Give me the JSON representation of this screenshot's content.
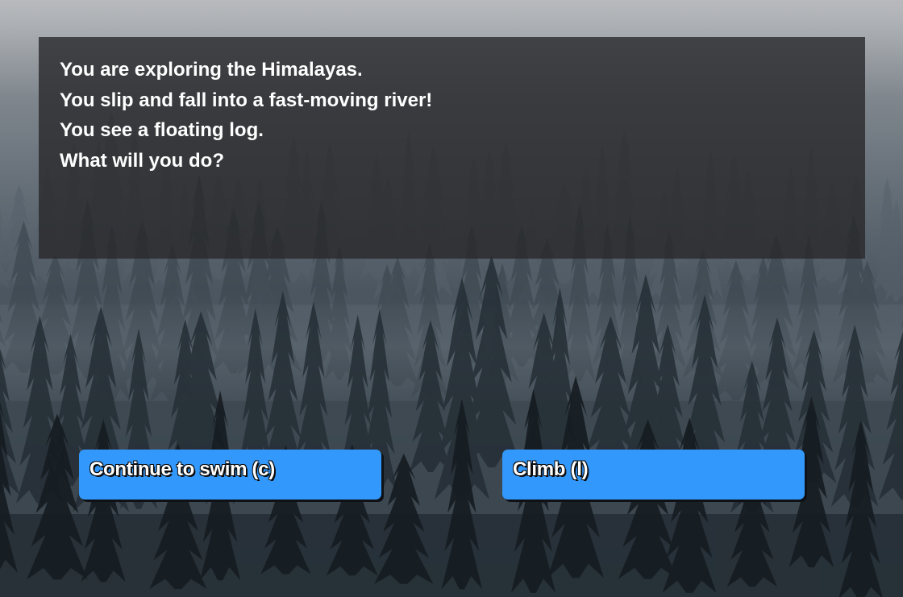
{
  "story": {
    "lines": [
      "You are exploring the Himalayas.",
      "You slip and fall into a fast-moving river!",
      "You see a floating log.",
      "What will you do?"
    ]
  },
  "choices": [
    {
      "label": "Continue to swim (c)"
    },
    {
      "label": "Climb (l)"
    }
  ],
  "colors": {
    "button": "#3398fb",
    "panel": "#28282a",
    "text": "#ffffff"
  },
  "background": "misty-pine-forest"
}
